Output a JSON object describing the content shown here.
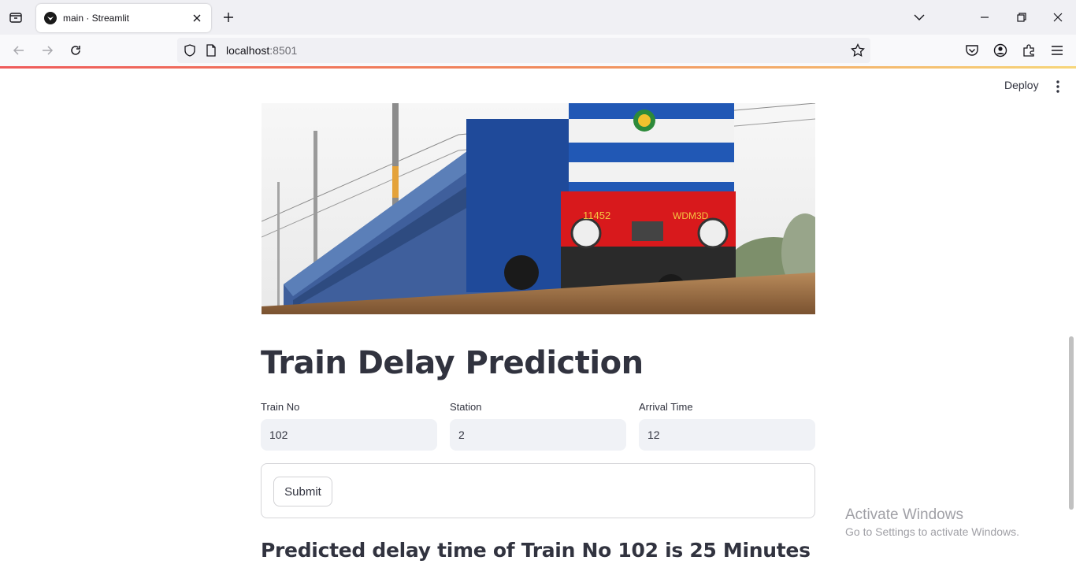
{
  "browser": {
    "tab_title": "main · Streamlit",
    "url_host": "localhost",
    "url_port": ":8501"
  },
  "app": {
    "deploy_label": "Deploy",
    "title": "Train Delay Prediction",
    "fields": [
      {
        "label": "Train No",
        "value": "102"
      },
      {
        "label": "Station",
        "value": "2"
      },
      {
        "label": "Arrival Time",
        "value": "12"
      }
    ],
    "submit_label": "Submit",
    "result_text": "Predicted delay time of Train No 102 is 25 Minutes"
  },
  "hero_image": {
    "train_number": "11452",
    "locomotive_mark": "WDM3D"
  },
  "watermark": {
    "title": "Activate Windows",
    "subtitle": "Go to Settings to activate Windows."
  }
}
